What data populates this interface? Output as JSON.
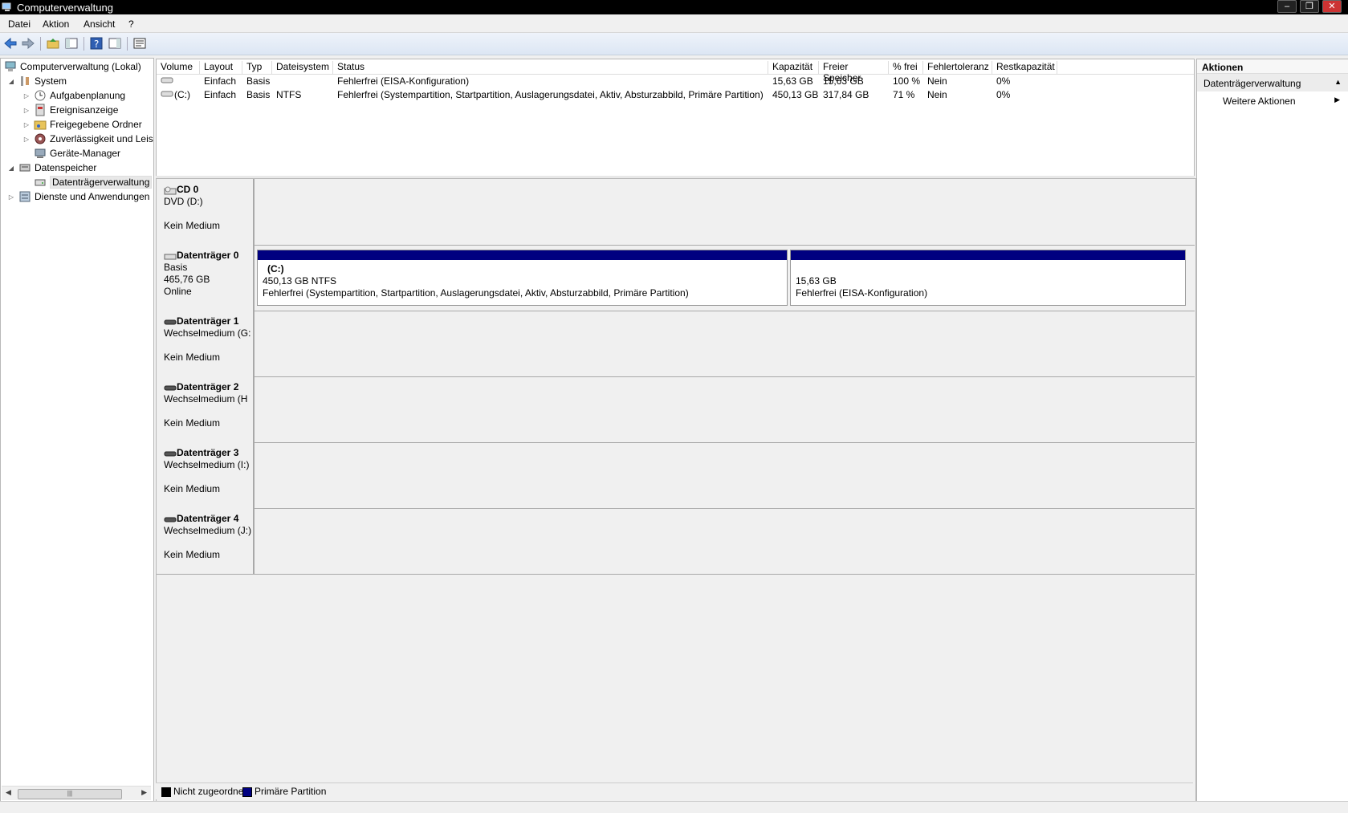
{
  "window": {
    "title": "Computerverwaltung",
    "controls": [
      "–",
      "❐",
      "✕"
    ]
  },
  "menu": [
    "Datei",
    "Aktion",
    "Ansicht",
    "?"
  ],
  "tree": {
    "root": "Computerverwaltung (Lokal)",
    "system": "System",
    "aufgaben": "Aufgabenplanung",
    "ereignis": "Ereignisanzeige",
    "freigegeben": "Freigegebene Ordner",
    "zuverl": "Zuverlässigkeit und Leis",
    "geraete": "Geräte-Manager",
    "datenspeicher": "Datenspeicher",
    "datentraeger": "Datenträgerverwaltung",
    "dienste": "Dienste und Anwendungen"
  },
  "volumes": {
    "headers": [
      "Volume",
      "Layout",
      "Typ",
      "Dateisystem",
      "Status",
      "Kapazität",
      "Freier Speicher",
      "% frei",
      "Fehlertoleranz",
      "Restkapazität"
    ],
    "rows": [
      [
        "",
        "Einfach",
        "Basis",
        "",
        "Fehlerfrei (EISA-Konfiguration)",
        "15,63 GB",
        "15,63 GB",
        "100 %",
        "Nein",
        "0%"
      ],
      [
        "(C:)",
        "Einfach",
        "Basis",
        "NTFS",
        "Fehlerfrei (Systempartition, Startpartition, Auslagerungsdatei, Aktiv, Absturzabbild, Primäre Partition)",
        "450,13 GB",
        "317,84 GB",
        "71 %",
        "Nein",
        "0%"
      ]
    ]
  },
  "disks": {
    "cd0": {
      "name": "CD 0",
      "line1": "DVD (D:)",
      "line3": "Kein Medium"
    },
    "d0": {
      "name": "Datenträger 0",
      "line1": "Basis",
      "line2": "465,76 GB",
      "line3": "Online",
      "p1": {
        "name": "(C:)",
        "size": "450,13 GB NTFS",
        "status": "Fehlerfrei (Systempartition, Startpartition, Auslagerungsdatei, Aktiv, Absturzabbild, Primäre Partition)"
      },
      "p2": {
        "size": "15,63 GB",
        "status": "Fehlerfrei (EISA-Konfiguration)"
      }
    },
    "d1": {
      "name": "Datenträger 1",
      "line1": "Wechselmedium (G:",
      "line3": "Kein Medium"
    },
    "d2": {
      "name": "Datenträger 2",
      "line1": "Wechselmedium (H",
      "line3": "Kein Medium"
    },
    "d3": {
      "name": "Datenträger 3",
      "line1": "Wechselmedium (I:)",
      "line3": "Kein Medium"
    },
    "d4": {
      "name": "Datenträger 4",
      "line1": "Wechselmedium (J:)",
      "line3": "Kein Medium"
    }
  },
  "legend": {
    "unallocated": "Nicht zugeordnet",
    "primary": "Primäre Partition",
    "unallocated_color": "#000000",
    "primary_color": "#000080"
  },
  "actions": {
    "title": "Aktionen",
    "section": "Datenträgerverwaltung",
    "more": "Weitere Aktionen"
  }
}
